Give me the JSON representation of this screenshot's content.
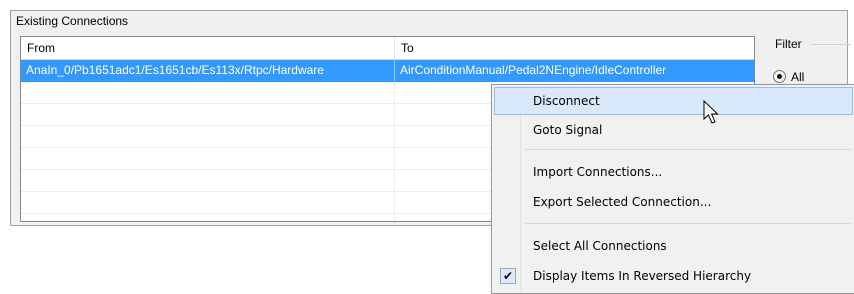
{
  "group": {
    "title": "Existing Connections"
  },
  "table": {
    "columns": [
      "From",
      "To"
    ],
    "rows": [
      {
        "from": "AnaIn_0/Pb1651adc1/Es1651cb/Es113x/Rtpc/Hardware",
        "to": "AirConditionManual/Pedal2NEngine/IdleController",
        "selected": true
      },
      {
        "from": "",
        "to": ""
      },
      {
        "from": "",
        "to": ""
      },
      {
        "from": "",
        "to": ""
      },
      {
        "from": "",
        "to": ""
      },
      {
        "from": "",
        "to": ""
      },
      {
        "from": "",
        "to": ""
      },
      {
        "from": "",
        "to": ""
      }
    ]
  },
  "filter": {
    "label": "Filter",
    "options": [
      {
        "label": "All",
        "selected": true
      }
    ]
  },
  "context_menu": {
    "items": [
      {
        "label": "Disconnect",
        "hovered": true
      },
      {
        "label": "Goto Signal"
      },
      {
        "label": "Import Connections..."
      },
      {
        "label": "Export Selected Connection..."
      },
      {
        "label": "Select All Connections"
      },
      {
        "label": "Display Items In Reversed Hierarchy",
        "checked": true
      }
    ]
  },
  "icons": {
    "check": "checkmark-icon",
    "cursor": "mouse-pointer-icon"
  },
  "colors": {
    "selection": "#3399ff",
    "menu_hover": "#d9e9fb",
    "menu_bg": "#f1f1f1"
  }
}
